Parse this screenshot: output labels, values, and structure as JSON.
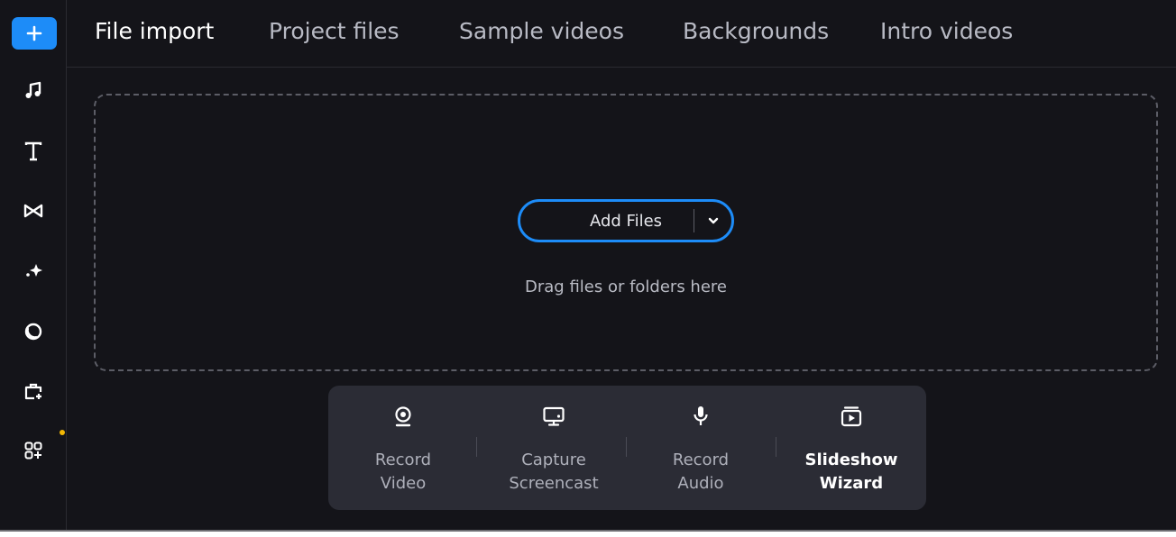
{
  "tabs": [
    {
      "label": "File import",
      "active": true
    },
    {
      "label": "Project files",
      "active": false
    },
    {
      "label": "Sample videos",
      "active": false
    },
    {
      "label": "Backgrounds",
      "active": false
    },
    {
      "label": "Intro videos",
      "active": false
    }
  ],
  "sidebar": {
    "items": [
      {
        "icon": "plus-icon"
      },
      {
        "icon": "music-note-icon"
      },
      {
        "icon": "text-icon"
      },
      {
        "icon": "transitions-icon"
      },
      {
        "icon": "sparkle-effects-icon"
      },
      {
        "icon": "filters-icon"
      },
      {
        "icon": "stickers-icon"
      },
      {
        "icon": "more-tools-icon",
        "notification": true
      }
    ]
  },
  "dropzone": {
    "add_files_label": "Add Files",
    "hint": "Drag files or folders here"
  },
  "tools": [
    {
      "line1": "Record",
      "line2": "Video",
      "icon": "webcam-icon"
    },
    {
      "line1": "Capture",
      "line2": "Screencast",
      "icon": "monitor-icon"
    },
    {
      "line1": "Record",
      "line2": "Audio",
      "icon": "microphone-icon"
    },
    {
      "line1": "Slideshow",
      "line2": "Wizard",
      "icon": "slideshow-icon"
    }
  ],
  "colors": {
    "accent": "#1d8cf8",
    "background": "#141419",
    "toolbar": "#2b2c35",
    "notification": "#f2b705"
  }
}
